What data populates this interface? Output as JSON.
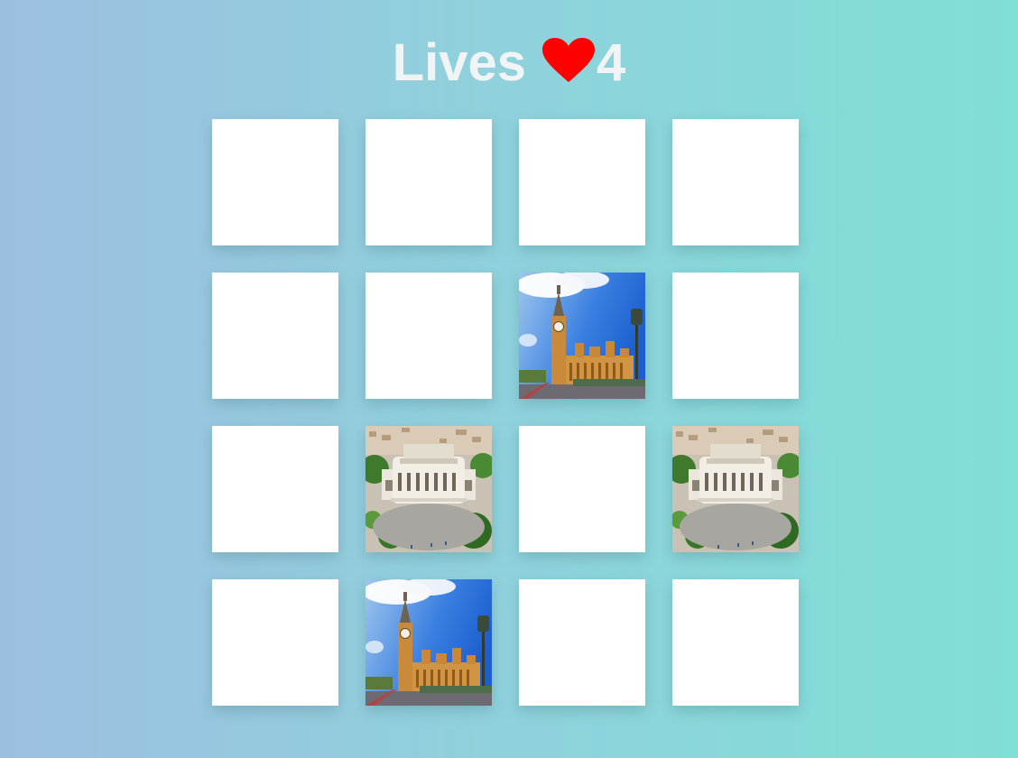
{
  "header": {
    "lives_label": "Lives",
    "lives_count": "4",
    "heart_color": "#ff0000"
  },
  "board": {
    "columns": 4,
    "rows": 4,
    "cards": [
      {
        "state": "hidden"
      },
      {
        "state": "hidden"
      },
      {
        "state": "hidden"
      },
      {
        "state": "hidden"
      },
      {
        "state": "hidden"
      },
      {
        "state": "hidden"
      },
      {
        "state": "revealed",
        "image": "big-ben"
      },
      {
        "state": "hidden"
      },
      {
        "state": "hidden"
      },
      {
        "state": "revealed",
        "image": "opera-house"
      },
      {
        "state": "hidden"
      },
      {
        "state": "revealed",
        "image": "opera-house"
      },
      {
        "state": "hidden"
      },
      {
        "state": "revealed",
        "image": "big-ben"
      },
      {
        "state": "hidden"
      },
      {
        "state": "hidden"
      }
    ]
  }
}
